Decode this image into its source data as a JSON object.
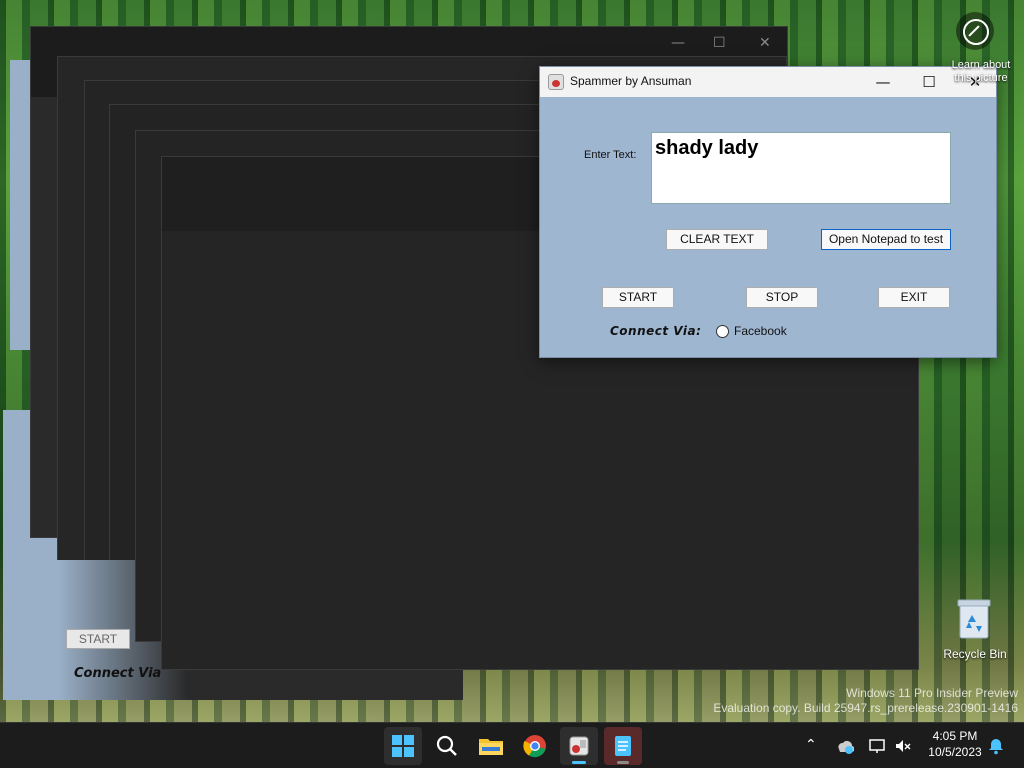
{
  "window": {
    "title": "Spammer by Ansuman",
    "controls": {
      "minimize": "—",
      "maximize": "☐",
      "close": "✕"
    },
    "enter_text_label": "Enter Text:",
    "text_value": "shady lady",
    "clear_text_button": "CLEAR TEXT",
    "open_notepad_button": "Open Notepad to test",
    "start_button": "START",
    "stop_button": "STOP",
    "exit_button": "EXIT",
    "connect_via_label": "Connect Via:",
    "facebook_option": "Facebook",
    "background_color": "#9fb6d1"
  },
  "ghost": {
    "start_button": "START",
    "connect_via_label": "Connect Via"
  },
  "desktop": {
    "learn_about_label": "Learn about\nthis picture",
    "recycle_bin_label": "Recycle Bin",
    "watermark_line1": "Windows 11 Pro Insider Preview",
    "watermark_line2": "Evaluation copy. Build 25947.rs_prerelease.230901-1416"
  },
  "taskbar": {
    "apps": [
      "start-icon",
      "search-icon",
      "file-explorer-icon",
      "chrome-icon",
      "spammer-app-icon",
      "notepad-icon"
    ],
    "time": "4:05 PM",
    "date": "10/5/2023",
    "accent_color": "#4cc2ff"
  }
}
